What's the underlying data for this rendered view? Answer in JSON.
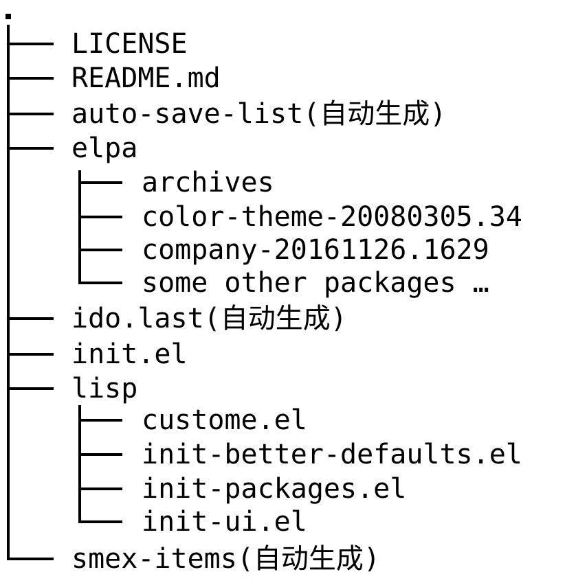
{
  "tree": {
    "root": ".",
    "items": [
      {
        "name": "LICENSE"
      },
      {
        "name": "README.md"
      },
      {
        "name": "auto-save-list(自动生成)"
      },
      {
        "name": "elpa",
        "children": [
          {
            "name": "archives"
          },
          {
            "name": "color-theme-20080305.34"
          },
          {
            "name": "company-20161126.1629"
          },
          {
            "name": "some other packages …"
          }
        ]
      },
      {
        "name": "ido.last(自动生成)"
      },
      {
        "name": "init.el"
      },
      {
        "name": "lisp",
        "children": [
          {
            "name": "custome.el"
          },
          {
            "name": "init-better-defaults.el"
          },
          {
            "name": "init-packages.el"
          },
          {
            "name": "init-ui.el"
          }
        ]
      },
      {
        "name": "smex-items(自动生成)"
      }
    ]
  }
}
